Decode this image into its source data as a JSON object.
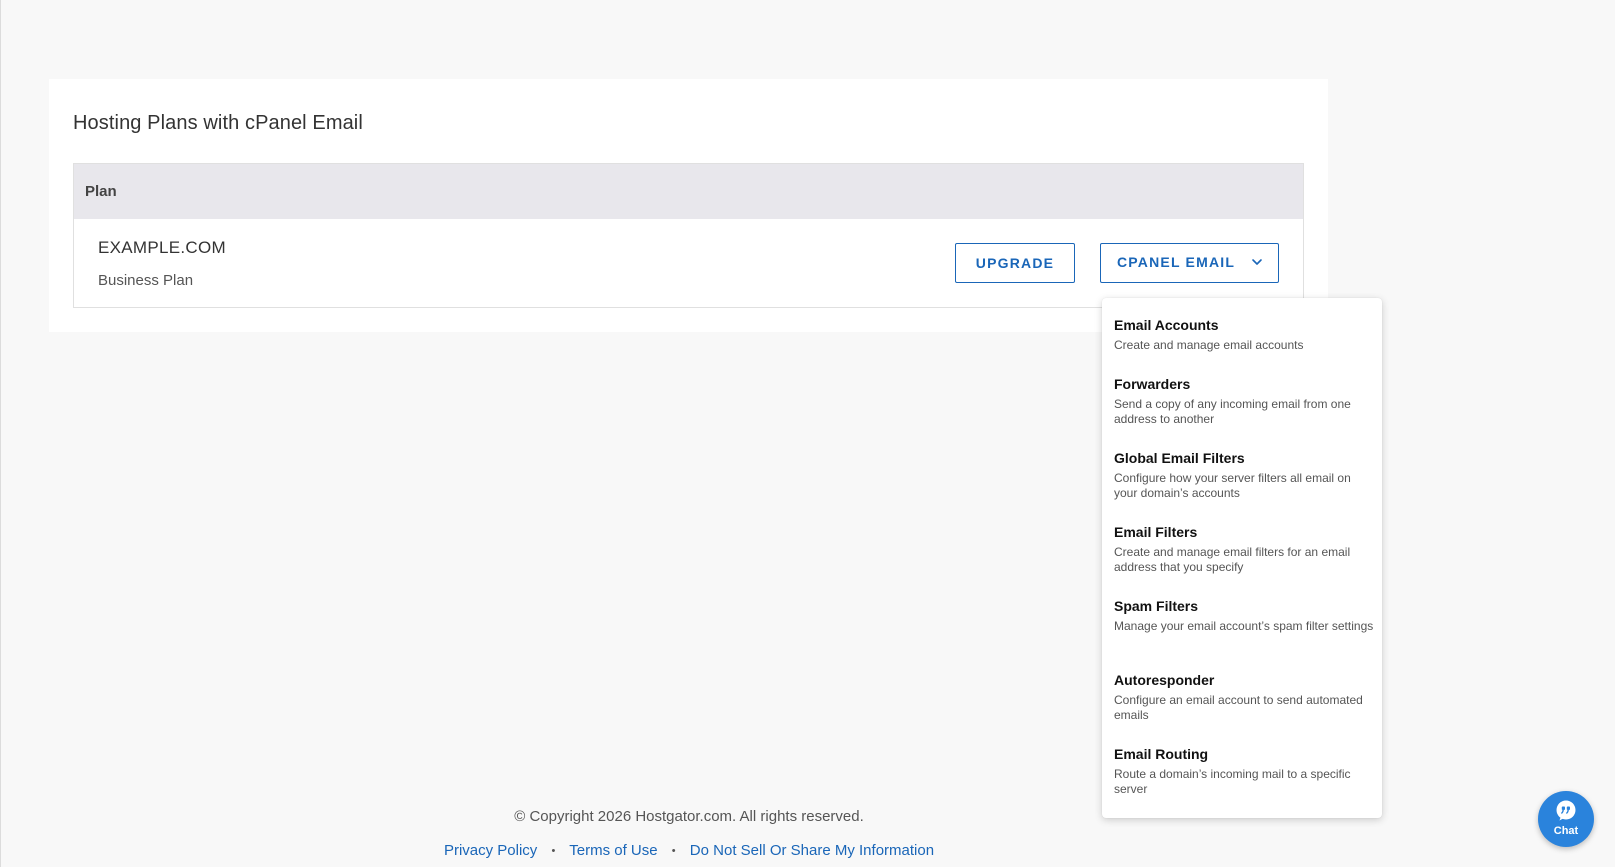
{
  "card": {
    "title": "Hosting Plans with cPanel Email"
  },
  "table": {
    "header_plan": "Plan",
    "row": {
      "domain": "EXAMPLE.COM",
      "plan_name": "Business Plan"
    }
  },
  "actions": {
    "upgrade_label": "UPGRADE",
    "cpanel_email_label": "CPANEL EMAIL"
  },
  "dropdown": {
    "items": [
      {
        "title": "Email Accounts",
        "desc": "Create and manage email accounts"
      },
      {
        "title": "Forwarders",
        "desc": "Send a copy of any incoming email from one address to another"
      },
      {
        "title": "Global Email Filters",
        "desc": "Configure how your server filters all email on your domain’s accounts"
      },
      {
        "title": "Email Filters",
        "desc": "Create and manage email filters for an email address that you specify"
      },
      {
        "title": "Spam Filters",
        "desc": "Manage your email account’s spam filter settings"
      },
      {
        "title": "Autoresponder",
        "desc": "Configure an email account to send automated emails"
      },
      {
        "title": "Email Routing",
        "desc": "Route a domain’s incoming mail to a specific server"
      }
    ]
  },
  "footer": {
    "copyright": "© Copyright 2026 Hostgator.com. All rights reserved.",
    "separator": "•",
    "links": {
      "privacy": "Privacy Policy",
      "terms": "Terms of Use",
      "do_not_sell": "Do Not Sell Or Share My Information"
    }
  },
  "chat": {
    "label": "Chat",
    "icon": "chat-bubble-icon"
  },
  "colors": {
    "accent": "#1a66b8",
    "chat_bg": "#2a83dc",
    "table_header_bg": "#e8e7ec",
    "page_bg": "#f8f8f8"
  }
}
